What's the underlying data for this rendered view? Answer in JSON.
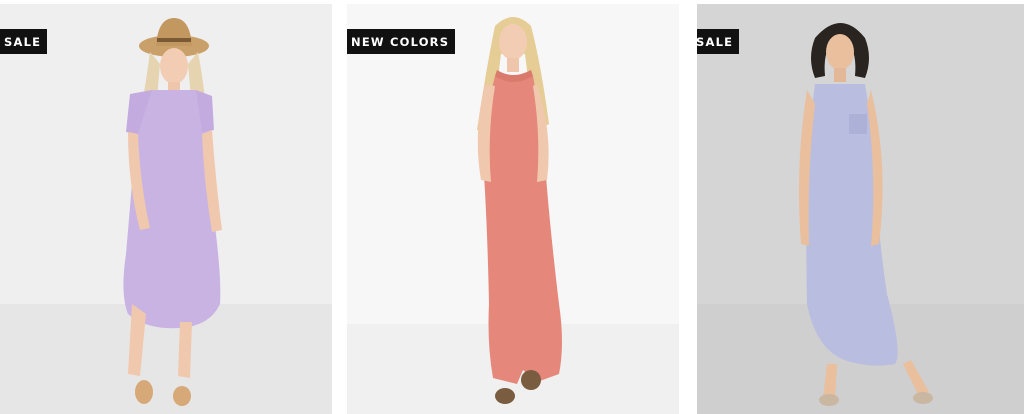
{
  "products": [
    {
      "badge": "SALE",
      "image_alt": "woman in lavender short-sleeve midi dress and tan hat",
      "background": "#efefef",
      "dress_color": "#c9b3e3"
    },
    {
      "badge": "NEW COLORS",
      "image_alt": "woman in coral sleeveless maxi dress with pockets",
      "background": "#f7f7f7",
      "dress_color": "#e5877a"
    },
    {
      "badge": "SALE",
      "image_alt": "woman in periwinkle sleeveless pocket tank maxi dress",
      "background": "#d5d5d5",
      "dress_color": "#b9bde0"
    }
  ]
}
